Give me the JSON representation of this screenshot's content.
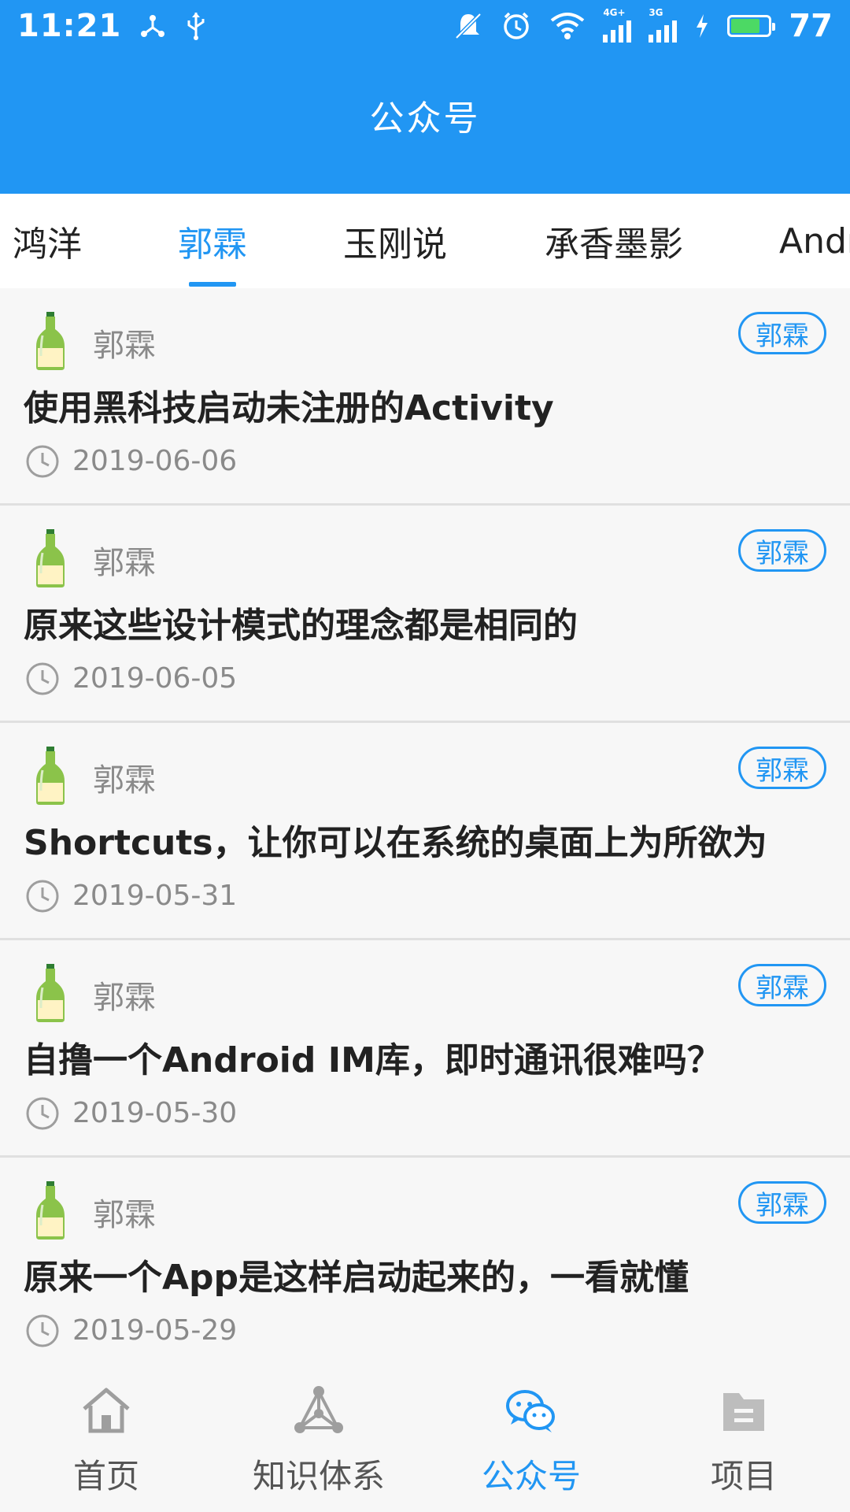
{
  "status_bar": {
    "time": "11:21",
    "network_1": "4G+",
    "network_2": "3G",
    "battery_percent": "77",
    "icons": [
      "usb-share-icon",
      "usb-icon",
      "mute-icon",
      "alarm-icon",
      "wifi-icon",
      "signal-icon",
      "charging-icon",
      "battery-icon"
    ],
    "battery_level": 0.77,
    "battery_color": "#4cd964"
  },
  "toolbar": {
    "title": "公众号"
  },
  "tabs": [
    {
      "label": "鸿洋",
      "active": false
    },
    {
      "label": "郭霖",
      "active": true
    },
    {
      "label": "玉刚说",
      "active": false
    },
    {
      "label": "承香墨影",
      "active": false
    },
    {
      "label": "Andr",
      "active": false
    }
  ],
  "articles": [
    {
      "author": "郭霖",
      "tag": "郭霖",
      "title": "使用黑科技启动未注册的Activity",
      "date": "2019-06-06"
    },
    {
      "author": "郭霖",
      "tag": "郭霖",
      "title": "原来这些设计模式的理念都是相同的",
      "date": "2019-06-05"
    },
    {
      "author": "郭霖",
      "tag": "郭霖",
      "title": "Shortcuts，让你可以在系统的桌面上为所欲为",
      "date": "2019-05-31"
    },
    {
      "author": "郭霖",
      "tag": "郭霖",
      "title": "自撸一个Android IM库，即时通讯很难吗？",
      "date": "2019-05-30"
    },
    {
      "author": "郭霖",
      "tag": "郭霖",
      "title": "原来一个App是这样启动起来的，一看就懂",
      "date": "2019-05-29"
    }
  ],
  "bottom_nav": [
    {
      "label": "首页",
      "icon": "home-icon",
      "active": false
    },
    {
      "label": "知识体系",
      "icon": "tree-icon",
      "active": false
    },
    {
      "label": "公众号",
      "icon": "wechat-icon",
      "active": true
    },
    {
      "label": "项目",
      "icon": "folder-icon",
      "active": false
    }
  ],
  "colors": {
    "primary": "#2196f3",
    "text": "#222222",
    "secondary_text": "#8a8a8a"
  }
}
